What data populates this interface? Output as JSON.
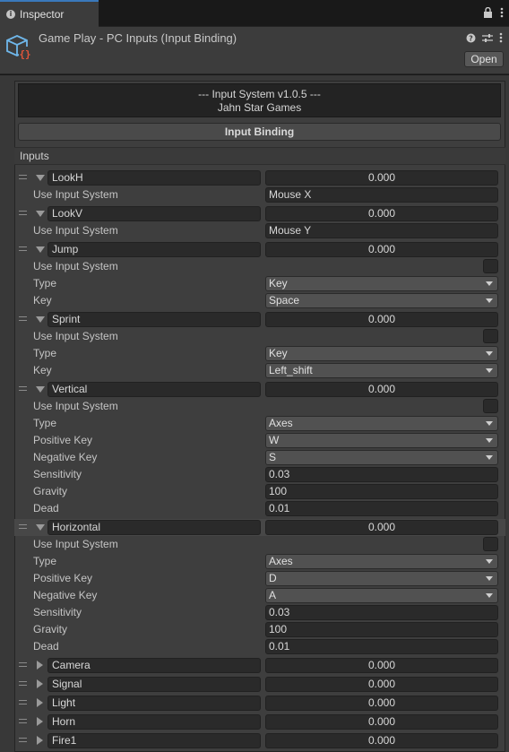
{
  "tab": {
    "icon": "info-icon",
    "label": "Inspector"
  },
  "header": {
    "title": "Game Play - PC Inputs (Input Binding)",
    "open_label": "Open",
    "icon": "script-cube-icon"
  },
  "banner": {
    "line1": "--- Input System v1.0.5 ---",
    "line2": "Jahn Star Games"
  },
  "binding_button": "Input Binding",
  "section_label": "Inputs",
  "labels": {
    "use_input_system": "Use Input System",
    "type": "Type",
    "key": "Key",
    "positive_key": "Positive Key",
    "negative_key": "Negative Key",
    "sensitivity": "Sensitivity",
    "gravity": "Gravity",
    "dead": "Dead"
  },
  "inputs": [
    {
      "name": "LookH",
      "value": "0.000",
      "expanded": true,
      "use_input_system": "Mouse X"
    },
    {
      "name": "LookV",
      "value": "0.000",
      "expanded": true,
      "use_input_system": "Mouse Y"
    },
    {
      "name": "Jump",
      "value": "0.000",
      "expanded": true,
      "type": "Key",
      "key": "Space"
    },
    {
      "name": "Sprint",
      "value": "0.000",
      "expanded": true,
      "type": "Key",
      "key": "Left_shift"
    },
    {
      "name": "Vertical",
      "value": "0.000",
      "expanded": true,
      "type": "Axes",
      "positive_key": "W",
      "negative_key": "S",
      "sensitivity": "0.03",
      "gravity": "100",
      "dead": "0.01"
    },
    {
      "name": "Horizontal",
      "value": "0.000",
      "expanded": true,
      "type": "Axes",
      "positive_key": "D",
      "negative_key": "A",
      "sensitivity": "0.03",
      "gravity": "100",
      "dead": "0.01"
    },
    {
      "name": "Camera",
      "value": "0.000",
      "expanded": false
    },
    {
      "name": "Signal",
      "value": "0.000",
      "expanded": false
    },
    {
      "name": "Light",
      "value": "0.000",
      "expanded": false
    },
    {
      "name": "Horn",
      "value": "0.000",
      "expanded": false
    },
    {
      "name": "Fire1",
      "value": "0.000",
      "expanded": false
    }
  ]
}
